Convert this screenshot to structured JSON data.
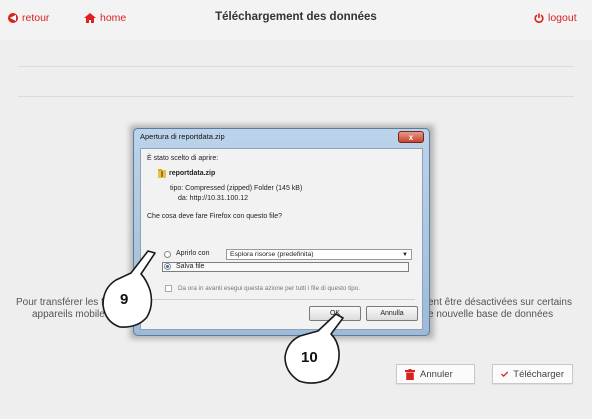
{
  "header": {
    "back_label": "retour",
    "home_label": "home",
    "title": "Téléchargement des données",
    "logout_label": "logout"
  },
  "info": {
    "left_line1": "Pour transférer les fich",
    "left_line2": "appareils mobiles.",
    "right_line1": "ent être désactivées sur certains",
    "right_line2": "e nouvelle base de données"
  },
  "actions": {
    "cancel_label": "Annuler",
    "download_label": "Télécharger"
  },
  "dialog": {
    "title": "Apertura di reportdata.zip",
    "close_label": "x",
    "intro": "È stato scelto di aprire:",
    "file_name": "reportdata.zip",
    "type_line": "tipo: Compressed (zipped) Folder (145 kB)",
    "from_line": "da: http://10.31.100.12",
    "question": "Che cosa deve fare Firefox con questo file?",
    "open_with_label": "Aprirlo con",
    "open_with_value": "Esplora risorse (predefinita)",
    "save_label": "Salva file",
    "remember_label": "Da ora in avanti esegui questa azione per tutti i file di questo tipo.",
    "ok_label": "OK",
    "cancel_label": "Annulla"
  },
  "callouts": {
    "step_9": "9",
    "step_10": "10"
  },
  "colors": {
    "accent": "#d8231f",
    "dialog_frame": "#a9c4e0"
  }
}
